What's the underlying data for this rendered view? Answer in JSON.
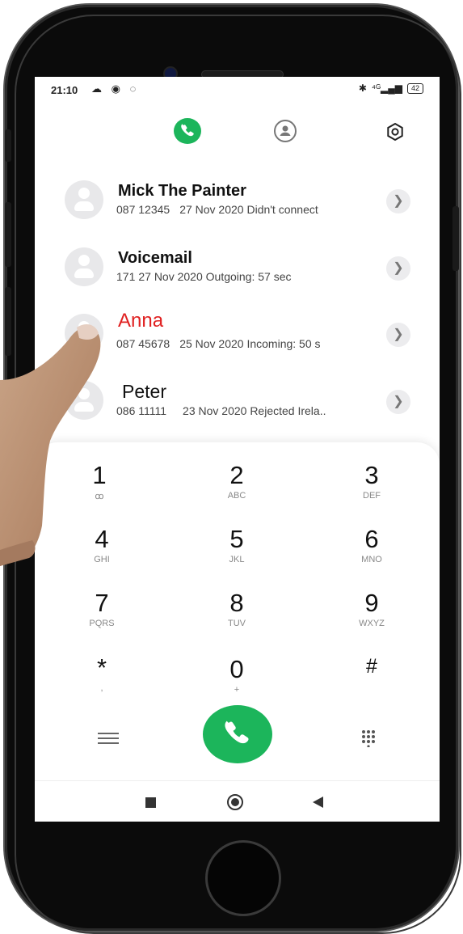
{
  "status_bar": {
    "time": "21:10",
    "left_icons": "☁ ◉ ◌",
    "bluetooth": "✱",
    "signal": "⁴ᴳ▂▄▆",
    "battery": "42"
  },
  "top_tabs": [
    {
      "name": "phone-icon",
      "active": true
    },
    {
      "name": "contacts-icon",
      "active": false
    },
    {
      "name": "settings-icon",
      "active": false
    }
  ],
  "calls": [
    {
      "name": "Mick The Painter",
      "number": "087 12345",
      "info": "27 Nov 2020 Didn't connect",
      "missed": false
    },
    {
      "name": "Voicemail",
      "number": "171",
      "info": "27 Nov 2020 Outgoing: 57 sec",
      "missed": false
    },
    {
      "name": "Anna",
      "number": "087 45678",
      "info": "25 Nov 2020 Incoming: 50 s",
      "missed": true
    },
    {
      "name": "Peter",
      "number": "086 11111",
      "info": "23 Nov 2020 Rejected  Irela..",
      "missed": false
    }
  ],
  "keypad": [
    {
      "digit": "1",
      "letters": "ꝏ"
    },
    {
      "digit": "2",
      "letters": "ABC"
    },
    {
      "digit": "3",
      "letters": "DEF"
    },
    {
      "digit": "4",
      "letters": "GHI"
    },
    {
      "digit": "5",
      "letters": "JKL"
    },
    {
      "digit": "6",
      "letters": "MNO"
    },
    {
      "digit": "7",
      "letters": "PQRS"
    },
    {
      "digit": "8",
      "letters": "TUV"
    },
    {
      "digit": "9",
      "letters": "WXYZ"
    },
    {
      "digit": "*",
      "letters": ","
    },
    {
      "digit": "0",
      "letters": "+"
    },
    {
      "digit": "#",
      "letters": ""
    }
  ],
  "colors": {
    "accent_green": "#1cb55b",
    "missed_red": "#e02020"
  }
}
